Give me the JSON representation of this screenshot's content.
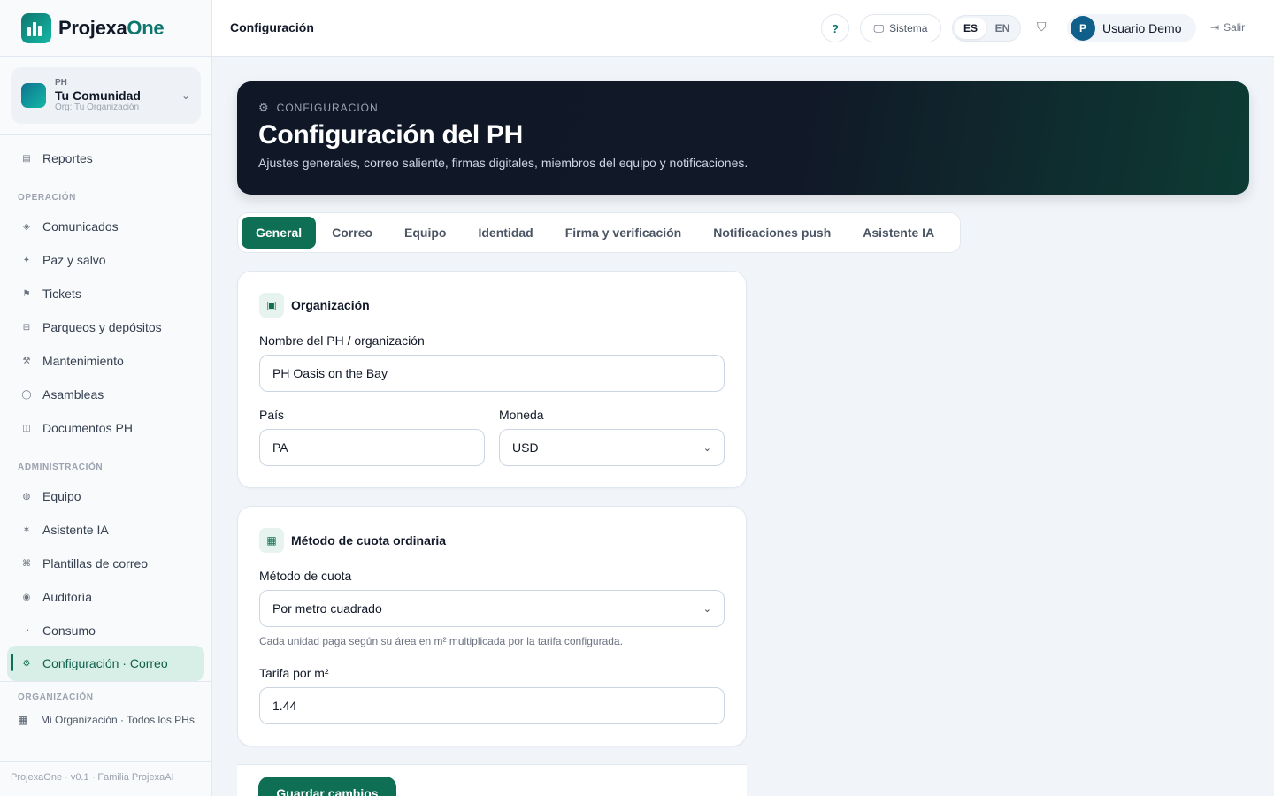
{
  "brand": {
    "name_prefix": "Projexa",
    "name_suffix": "One"
  },
  "community": {
    "tag": "PH",
    "name": "Tu Comunidad",
    "org": "Org: Tu Organización"
  },
  "sidebar": {
    "top_items": [
      {
        "label": "Reportes",
        "icon": "bars-icon"
      }
    ],
    "sections": [
      {
        "label": "OPERACIÓN",
        "items": [
          {
            "label": "Comunicados",
            "icon": "diamond-icon"
          },
          {
            "label": "Paz y salvo",
            "icon": "sparkle-icon"
          },
          {
            "label": "Tickets",
            "icon": "flag-icon"
          },
          {
            "label": "Parqueos y depósitos",
            "icon": "box-icon"
          },
          {
            "label": "Mantenimiento",
            "icon": "tools-icon"
          },
          {
            "label": "Asambleas",
            "icon": "circle-icon"
          },
          {
            "label": "Documentos PH",
            "icon": "grid-icon"
          }
        ]
      },
      {
        "label": "ADMINISTRACIÓN",
        "items": [
          {
            "label": "Equipo",
            "icon": "people-icon"
          },
          {
            "label": "Asistente IA",
            "icon": "asterisk-icon"
          },
          {
            "label": "Plantillas de correo",
            "icon": "command-icon"
          },
          {
            "label": "Auditoría",
            "icon": "target-icon"
          },
          {
            "label": "Consumo",
            "icon": "pie-icon"
          },
          {
            "label": "Configuración · Correo",
            "icon": "gear-icon",
            "active": true
          }
        ]
      }
    ],
    "org_section": {
      "label": "ORGANIZACIÓN",
      "link": "Mi Organización · Todos los PHs"
    },
    "footer": "ProjexaOne · v0.1 · Familia ProjexaAI"
  },
  "topbar": {
    "title": "Configuración",
    "help": "?",
    "system": "Sistema",
    "lang": [
      "ES",
      "EN"
    ],
    "lang_active": "ES",
    "user_initial": "P",
    "user_name": "Usuario Demo",
    "logout": "Salir"
  },
  "hero": {
    "eyebrow": "CONFIGURACIÓN",
    "title": "Configuración del PH",
    "subtitle": "Ajustes generales, correo saliente, firmas digitales, miembros del equipo y notificaciones."
  },
  "tabs": [
    "General",
    "Correo",
    "Equipo",
    "Identidad",
    "Firma y verificación",
    "Notificaciones push",
    "Asistente IA"
  ],
  "org_card": {
    "title": "Organización",
    "name_label": "Nombre del PH / organización",
    "name_value": "PH Oasis on the Bay",
    "country_label": "País",
    "country_value": "PA",
    "currency_label": "Moneda",
    "currency_value": "USD"
  },
  "fee_card": {
    "title": "Método de cuota ordinaria",
    "method_label": "Método de cuota",
    "method_value": "Por metro cuadrado",
    "method_help": "Cada unidad paga según su área en m² multiplicada por la tarifa configurada.",
    "rate_label": "Tarifa por m²",
    "rate_value": "1.44"
  },
  "save_label": "Guardar cambios",
  "colors": {
    "primary": "#0f6f55",
    "hero_bg": "#111827",
    "active_nav_bg": "#d7efe6"
  }
}
